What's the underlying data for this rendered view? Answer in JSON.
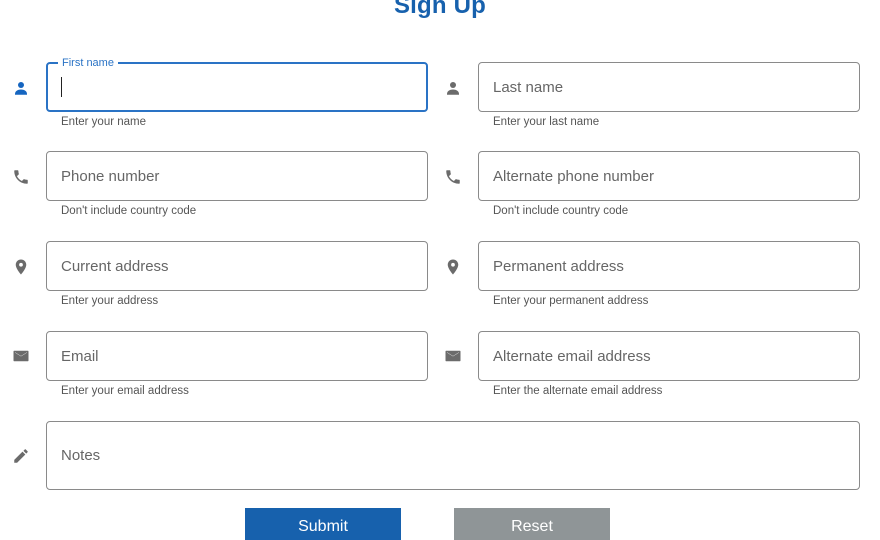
{
  "form": {
    "title": "Sign Up",
    "first_name": {
      "label": "First name",
      "value": "",
      "helper": "Enter your name",
      "icon": "person-icon"
    },
    "last_name": {
      "placeholder": "Last name",
      "helper": "Enter your last name",
      "icon": "person-icon"
    },
    "phone": {
      "placeholder": "Phone number",
      "helper": "Don't include country code",
      "icon": "phone-icon"
    },
    "alt_phone": {
      "placeholder": "Alternate phone number",
      "helper": "Don't include country code",
      "icon": "phone-icon"
    },
    "current_address": {
      "placeholder": "Current address",
      "helper": "Enter your address",
      "icon": "location-pin-icon"
    },
    "permanent_address": {
      "placeholder": "Permanent address",
      "helper": "Enter your permanent address",
      "icon": "location-pin-icon"
    },
    "email": {
      "placeholder": "Email",
      "helper": "Enter your email address",
      "icon": "mail-icon"
    },
    "alt_email": {
      "placeholder": "Alternate email address",
      "helper": "Enter the alternate email address",
      "icon": "mail-icon"
    },
    "notes": {
      "placeholder": "Notes",
      "icon": "pencil-icon"
    },
    "submit_label": "Submit",
    "reset_label": "Reset"
  },
  "colors": {
    "primary": "#1761ad",
    "focus": "#2a73c5",
    "reset": "#8f9597",
    "icon": "#6b6b6b"
  }
}
